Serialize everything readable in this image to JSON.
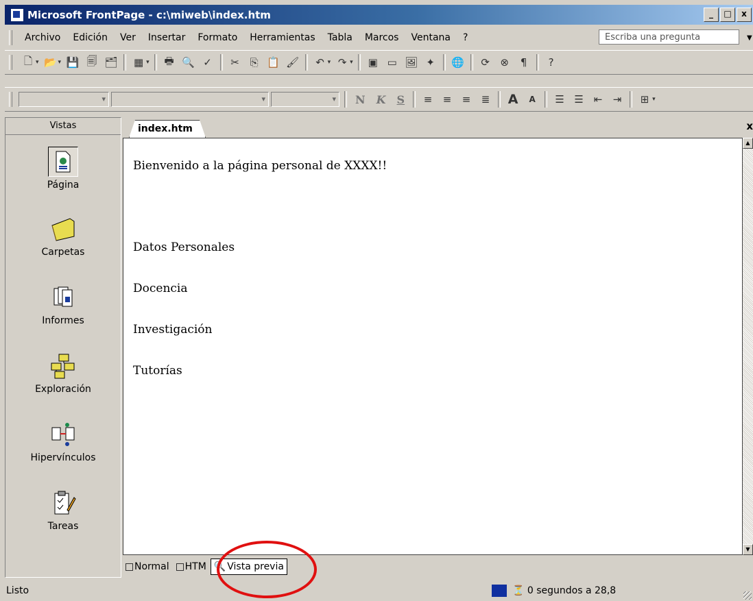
{
  "window": {
    "title": "Microsoft FrontPage - c:\\miweb\\index.htm",
    "buttons": [
      "_",
      "□",
      "x"
    ]
  },
  "menu": {
    "items": [
      "Archivo",
      "Edición",
      "Ver",
      "Insertar",
      "Formato",
      "Herramientas",
      "Tabla",
      "Marcos",
      "Ventana",
      "?"
    ],
    "ask_placeholder": "Escriba una pregunta"
  },
  "format_toolbar": {
    "bold": "N",
    "italic": "K",
    "underline": "S"
  },
  "views": {
    "header": "Vistas",
    "items": [
      {
        "label": "Página",
        "icon": "page-icon",
        "selected": true
      },
      {
        "label": "Carpetas",
        "icon": "folder-icon"
      },
      {
        "label": "Informes",
        "icon": "reports-icon"
      },
      {
        "label": "Exploración",
        "icon": "navigation-icon"
      },
      {
        "label": "Hipervínculos",
        "icon": "hyperlinks-icon"
      },
      {
        "label": "Tareas",
        "icon": "tasks-icon"
      }
    ]
  },
  "editor": {
    "tab": "index.htm",
    "close": "x",
    "lines": [
      "Bienvenido a la página personal de XXXX!!",
      "Datos Personales",
      "Docencia",
      "Investigación",
      "Tutorías"
    ]
  },
  "view_tabs": [
    "Normal",
    "HTML",
    "Vista previa"
  ],
  "view_tabs_visible": [
    "Normal",
    "HTM",
    "Vista previa"
  ],
  "status": {
    "text": "Listo",
    "time": "0 segundos a 28,8"
  },
  "colors": {
    "titlebar": "#0a246a",
    "highlight_circle": "#e01010"
  }
}
